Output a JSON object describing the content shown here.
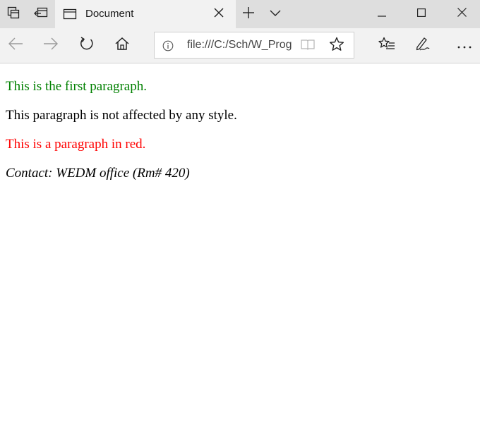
{
  "tab": {
    "title": "Document"
  },
  "toolbar": {
    "address": "file:///C:/Sch/W_Prog"
  },
  "page": {
    "paragraphs": [
      {
        "text": "This is the first paragraph.",
        "color": "#008000"
      },
      {
        "text": "This paragraph is not affected by any style.",
        "color": "#000000"
      },
      {
        "text": "This is a paragraph in red.",
        "color": "#ff0000"
      }
    ],
    "contact": "Contact: WEDM office (Rm# 420)"
  },
  "icons": {
    "tab_set_aside": "tabs-aside-icon",
    "tab_restore": "tabs-restore-icon",
    "favicon": "page-icon",
    "close_tab": "close-icon",
    "new_tab": "plus-icon",
    "tab_list": "chevron-down-icon",
    "minimize": "minimize-icon",
    "maximize": "maximize-icon",
    "close_window": "close-icon",
    "back": "back-arrow-icon",
    "forward": "forward-arrow-icon",
    "refresh": "refresh-icon",
    "home": "home-icon",
    "info": "info-icon",
    "reading_view": "book-icon",
    "favorite": "star-icon",
    "favorites_hub": "favorites-list-icon",
    "notes": "pen-icon",
    "more": "more-icon"
  }
}
